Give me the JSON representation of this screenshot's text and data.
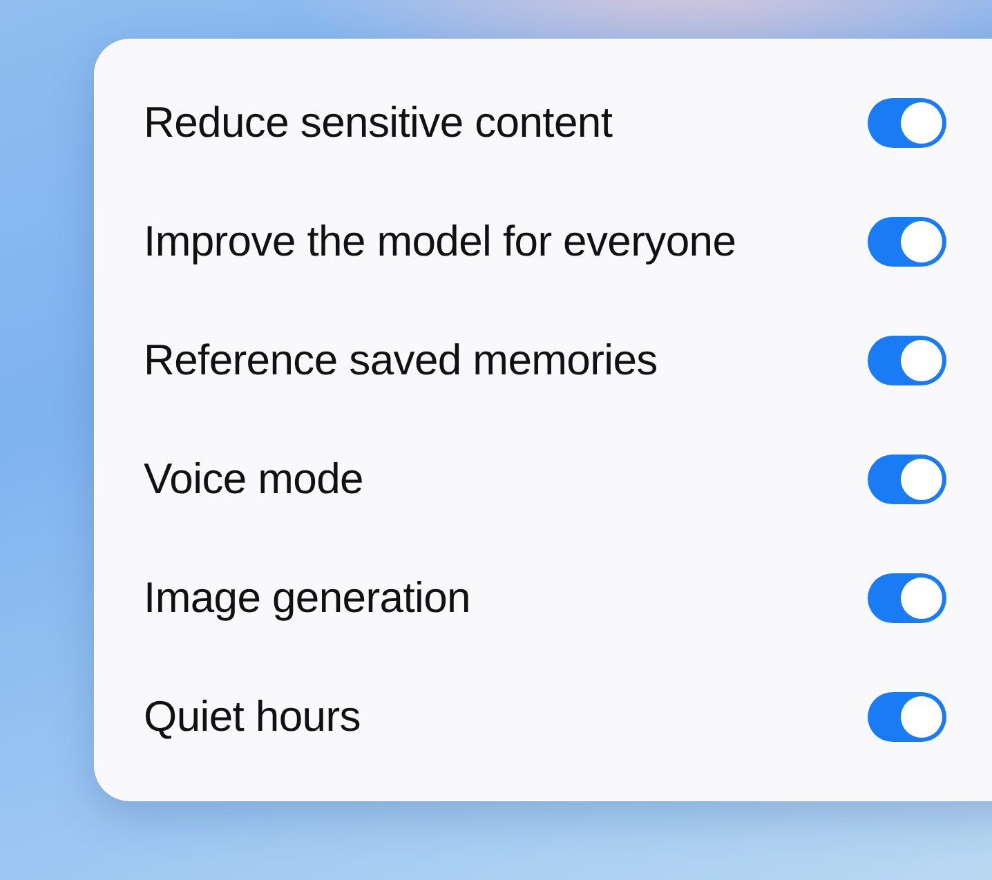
{
  "settings": [
    {
      "label": "Reduce sensitive content",
      "on": true
    },
    {
      "label": "Improve the model for everyone",
      "on": true
    },
    {
      "label": "Reference saved memories",
      "on": true
    },
    {
      "label": "Voice mode",
      "on": true
    },
    {
      "label": "Image generation",
      "on": true
    },
    {
      "label": "Quiet hours",
      "on": true
    }
  ]
}
